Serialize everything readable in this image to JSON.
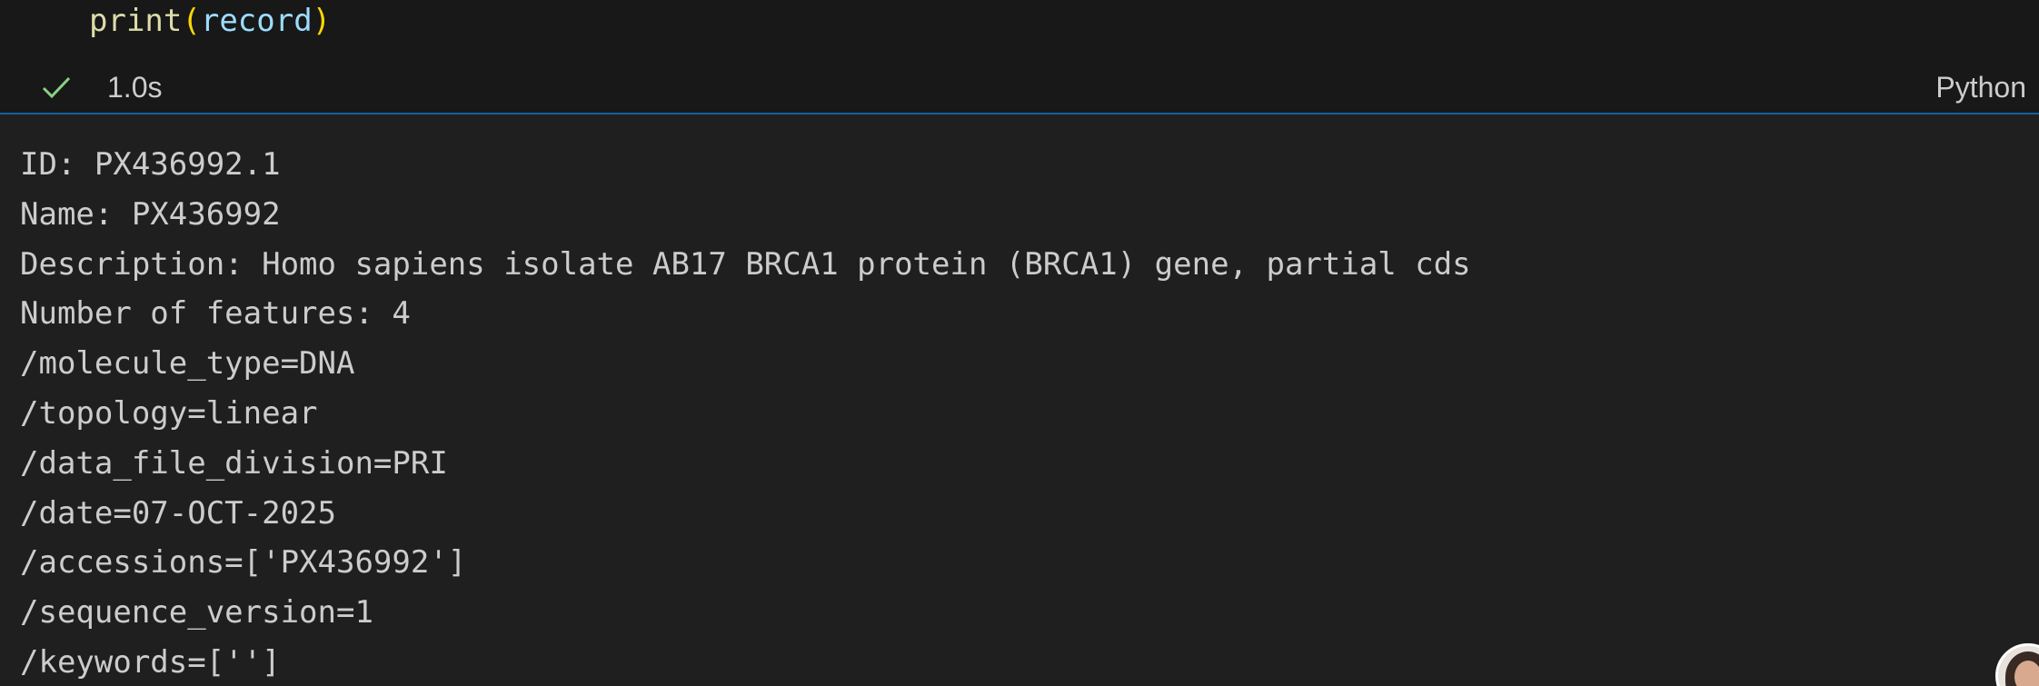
{
  "code_cell": {
    "tokens": {
      "fn": "print",
      "open_paren": "(",
      "arg": "record",
      "close_paren": ")"
    },
    "status": {
      "success_icon": "check-icon",
      "exec_time": "1.0s",
      "language": "Python"
    }
  },
  "output": {
    "lines": [
      "ID: PX436992.1",
      "Name: PX436992",
      "Description: Homo sapiens isolate AB17 BRCA1 protein (BRCA1) gene, partial cds",
      "Number of features: 4",
      "/molecule_type=DNA",
      "/topology=linear",
      "/data_file_division=PRI",
      "/date=07-OCT-2025",
      "/accessions=['PX436992']",
      "/sequence_version=1",
      "/keywords=['']"
    ]
  },
  "colors": {
    "background": "#1f1f1f",
    "cell_background": "#181818",
    "accent_divider": "#0e639c",
    "success": "#89d185",
    "text": "#cccccc"
  }
}
